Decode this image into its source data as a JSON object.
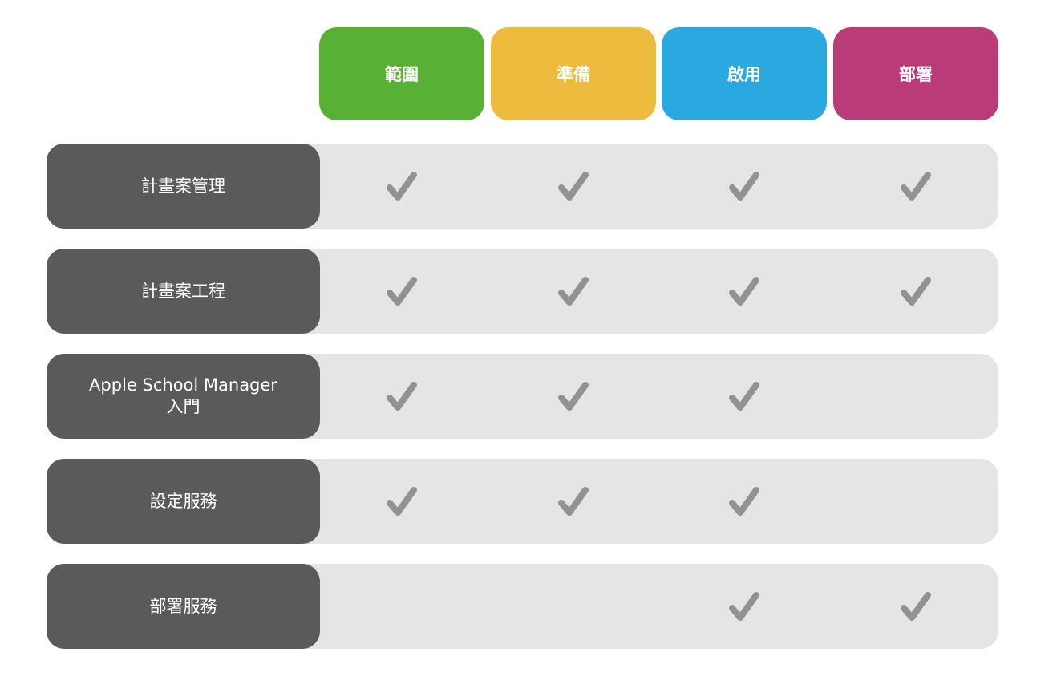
{
  "colors": {
    "scope": "#58b135",
    "prepare": "#edbc3f",
    "enable": "#2aa9e0",
    "deploy": "#b93b78",
    "label_bg": "#5a5a5a",
    "track_bg": "#e5e5e5",
    "check": "#929292"
  },
  "phases": [
    {
      "label": "範圍",
      "key": "scope"
    },
    {
      "label": "準備",
      "key": "prepare"
    },
    {
      "label": "啟用",
      "key": "enable"
    },
    {
      "label": "部署",
      "key": "deploy"
    }
  ],
  "rows": [
    {
      "label": "計畫案管理",
      "checks": [
        true,
        true,
        true,
        true
      ]
    },
    {
      "label": "計畫案工程",
      "checks": [
        true,
        true,
        true,
        true
      ]
    },
    {
      "label": "Apple School Manager\n入門",
      "checks": [
        true,
        true,
        true,
        false
      ]
    },
    {
      "label": "設定服務",
      "checks": [
        true,
        true,
        true,
        false
      ]
    },
    {
      "label": "部署服務",
      "checks": [
        false,
        false,
        true,
        true
      ]
    }
  ]
}
